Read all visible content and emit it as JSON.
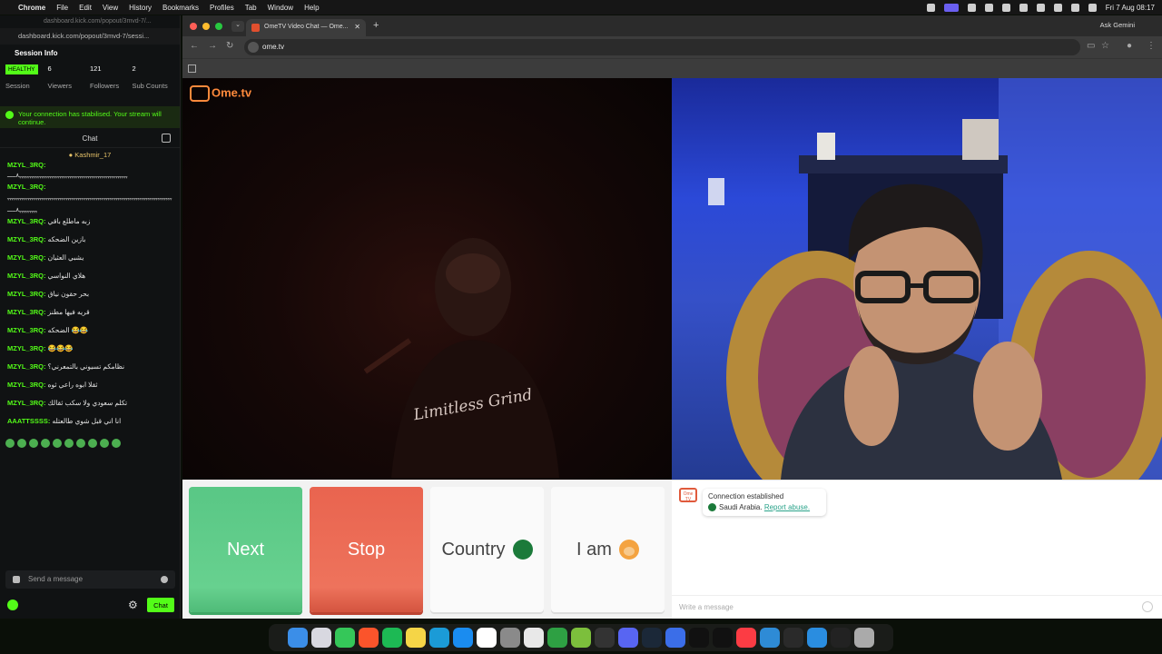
{
  "menubar": {
    "app": "Chrome",
    "items": [
      "File",
      "Edit",
      "View",
      "History",
      "Bookmarks",
      "Profiles",
      "Tab",
      "Window",
      "Help"
    ],
    "clock": "Fri 7 Aug  08:17"
  },
  "kick": {
    "tab_url": "dashboard.kick.com/popout/3mvd-7/...",
    "url": "dashboard.kick.com/popout/3mvd-7/sessi...",
    "session_title": "Session Info",
    "health_badge": "HEALTHY",
    "session_label": "Session",
    "stats": [
      {
        "value": "6",
        "label": "Viewers"
      },
      {
        "value": "121",
        "label": "Followers"
      },
      {
        "value": "2",
        "label": "Sub Counts"
      }
    ],
    "notice": "Your connection has stabilised. Your stream will continue.",
    "chat_title": "Chat",
    "pinned_user": "Kashmir_17",
    "messages": [
      {
        "user": "MZYL_3RQ:",
        "text": "ﮩﮩﮩﮩﮩﮩﮩﮩﮩﮩﮩﮩﮩﮩﮩﮩﮩﮩﮩﮩﮩﮩﮩﮩﮩﮩﮩﮩﮩﮩﮩﮩﮩﮩﮩﮩﮩﮩﮩﮩﮩﮩﮩﮩﮩﮩﮩﮩﮩﮩﮩﮩﮩﮩ٨ـــــ",
        "tall": true
      },
      {
        "user": "MZYL_3RQ:",
        "text": "ﮩﮩﮩﮩﮩﮩﮩﮩﮩﮩﮩﮩﮩﮩﮩﮩﮩﮩﮩﮩﮩﮩﮩﮩﮩﮩﮩﮩﮩﮩﮩﮩﮩﮩﮩﮩﮩﮩﮩﮩﮩﮩﮩﮩﮩﮩﮩﮩﮩﮩﮩﮩﮩﮩﮩﮩﮩﮩﮩﮩﮩﮩﮩﮩﮩﮩﮩﮩﮩﮩﮩﮩﮩﮩﮩﮩﮩﮩﮩﮩﮩﮩﮩﮩﮩﮩﮩﮩﮩﮩﮩ٨ـــــ",
        "tall": true
      },
      {
        "user": "MZYL_3RQ:",
        "text": "زبه ماطلع باقي"
      },
      {
        "user": "MZYL_3RQ:",
        "text": "بازين الضحكه"
      },
      {
        "user": "MZYL_3RQ:",
        "text": "يشبي العثيان"
      },
      {
        "user": "MZYL_3RQ:",
        "text": "هلاي النواسي"
      },
      {
        "user": "MZYL_3RQ:",
        "text": "بحر حقون نياق"
      },
      {
        "user": "MZYL_3RQ:",
        "text": "قريه فيها مطنز"
      },
      {
        "user": "MZYL_3RQ:",
        "text": "الضحكه 😂😂"
      },
      {
        "user": "MZYL_3RQ:",
        "text": "😂😂😂"
      },
      {
        "user": "MZYL_3RQ:",
        "text": "نظامكم تسيوني بالتمعرني؟"
      },
      {
        "user": "MZYL_3RQ:",
        "text": "ثقلا ابوه راعي ثوه"
      },
      {
        "user": "MZYL_3RQ:",
        "text": "تكلم سعودي ولا سكب ثقالك"
      },
      {
        "user": "AAATTSSSS:",
        "text": "انا اني قبل شوي طالعتله"
      }
    ],
    "send_placeholder": "Send a message",
    "chat_button": "Chat"
  },
  "browser": {
    "tab_title": "OmeTV Video Chat — Ome...",
    "ask_gemini": "Ask Gemini",
    "url": "ome.tv"
  },
  "ometv": {
    "logo": "Ome.tv",
    "shirt_text": "Limitless Grind",
    "buttons": {
      "next": "Next",
      "stop": "Stop",
      "country": "Country",
      "iam": "I am"
    },
    "system_message": {
      "line1": "Connection established",
      "country": "Saudi Arabia.",
      "report": "Report abuse."
    },
    "write_placeholder": "Write a message"
  },
  "colors": {
    "kick_green": "#53fc18",
    "next_green": "#5fcc8a",
    "stop_red": "#ec6c56"
  }
}
